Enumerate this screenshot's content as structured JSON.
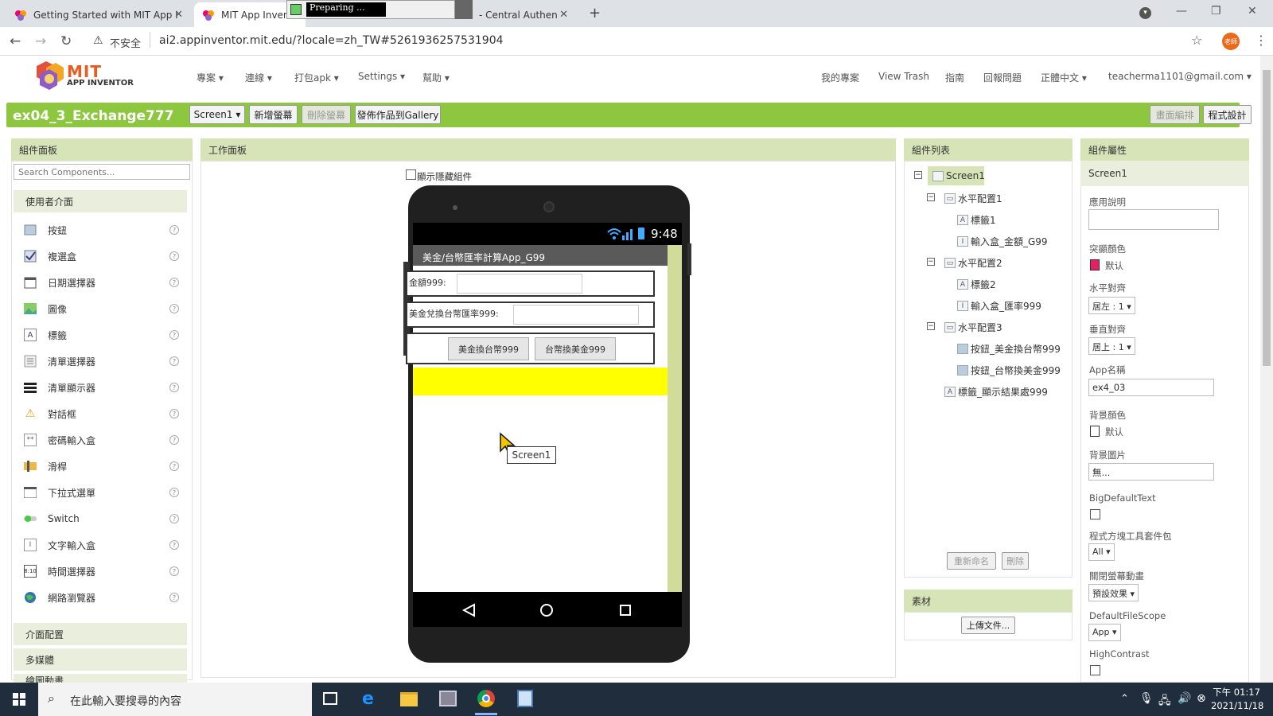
{
  "browser": {
    "tabs": [
      {
        "title": "Getting Started with MIT App I"
      },
      {
        "title": "MIT App Inven"
      },
      {
        "title": "- Central Authen"
      }
    ],
    "new_tab": "+",
    "progress_popup": "Preparing ...",
    "security_label": "不安全",
    "url": "ai2.appinventor.mit.edu/?locale=zh_TW#5261936257531904",
    "profile_badge": "老師"
  },
  "app": {
    "logo_title": "MIT",
    "logo_sub": "APP INVENTOR",
    "menus": [
      "專案",
      "連線",
      "打包apk",
      "Settings",
      "幫助"
    ],
    "right_links": [
      "我的專案",
      "View Trash",
      "指南",
      "回報問題",
      "正體中文",
      "teacherma1101@gmail.com"
    ],
    "project_name": "ex04_3_Exchange777",
    "screen_select": "Screen1",
    "add_screen": "新增螢幕",
    "remove_screen": "刪除螢幕",
    "publish_gallery": "發佈作品到Gallery",
    "designer_btn": "畫面編排",
    "blocks_btn": "程式設計"
  },
  "palette": {
    "header": "組件面板",
    "search_placeholder": "Search Components...",
    "category_ui": "使用者介面",
    "items": [
      "按鈕",
      "複選盒",
      "日期選擇器",
      "圖像",
      "標籤",
      "清單選擇器",
      "清單顯示器",
      "對話框",
      "密碼輸入盒",
      "滑桿",
      "下拉式選單",
      "Switch",
      "文字輸入盒",
      "時間選擇器",
      "網路瀏覽器"
    ],
    "help": "?",
    "category_layout": "介面配置",
    "category_media": "多媒體",
    "category_drawing": "繪圖動畫"
  },
  "viewer": {
    "header": "工作面板",
    "show_hidden": "顯示隱藏組件",
    "status_time": "9:48",
    "title_bar": "美金/台幣匯率計算App_G99",
    "label1": "金額999:",
    "label2": "美金兌換台幣匯率999:",
    "btn_usd_twd": "美金換台幣999",
    "btn_twd_usd": "台幣換美金999",
    "drag_tooltip": "Screen1",
    "result_color": "#ffff00"
  },
  "tree": {
    "header": "組件列表",
    "items": [
      {
        "label": "Screen1"
      },
      {
        "label": "水平配置1"
      },
      {
        "label": "標籤1"
      },
      {
        "label": "輸入盒_金額_G99"
      },
      {
        "label": "水平配置2"
      },
      {
        "label": "標籤2"
      },
      {
        "label": "輸入盒_匯率999"
      },
      {
        "label": "水平配置3"
      },
      {
        "label": "按鈕_美金換台幣999"
      },
      {
        "label": "按鈕_台幣換美金999"
      },
      {
        "label": "標籤_顯示結果處999"
      }
    ],
    "rename_btn": "重新命名",
    "delete_btn": "刪除",
    "media_header": "素材",
    "upload_btn": "上傳文件..."
  },
  "props": {
    "header": "組件屬性",
    "component": "Screen1",
    "about_label": "應用說明",
    "accent_label": "突顯顏色",
    "accent_value": "默认",
    "accent_color": "#e91e63",
    "align_h_label": "水平對齊",
    "align_h_value": "居左 : 1",
    "align_v_label": "垂直對齊",
    "align_v_value": "居上 : 1",
    "appname_label": "App名稱",
    "appname_value": "ex4_03",
    "bgcolor_label": "背景顏色",
    "bgcolor_value": "默认",
    "bgimage_label": "背景圖片",
    "bgimage_value": "無...",
    "bigtext_label": "BigDefaultText",
    "blocks_toolkit_label": "程式方塊工具套件包",
    "blocks_toolkit_value": "All",
    "close_anim_label": "關閉螢幕動畫",
    "close_anim_value": "預設效果",
    "filescope_label": "DefaultFileScope",
    "filescope_value": "App",
    "contrast_label": "HighContrast"
  },
  "taskbar": {
    "search_placeholder": "在此輸入要搜尋的內容",
    "time": "下午 01:17",
    "date": "2021/11/18"
  }
}
